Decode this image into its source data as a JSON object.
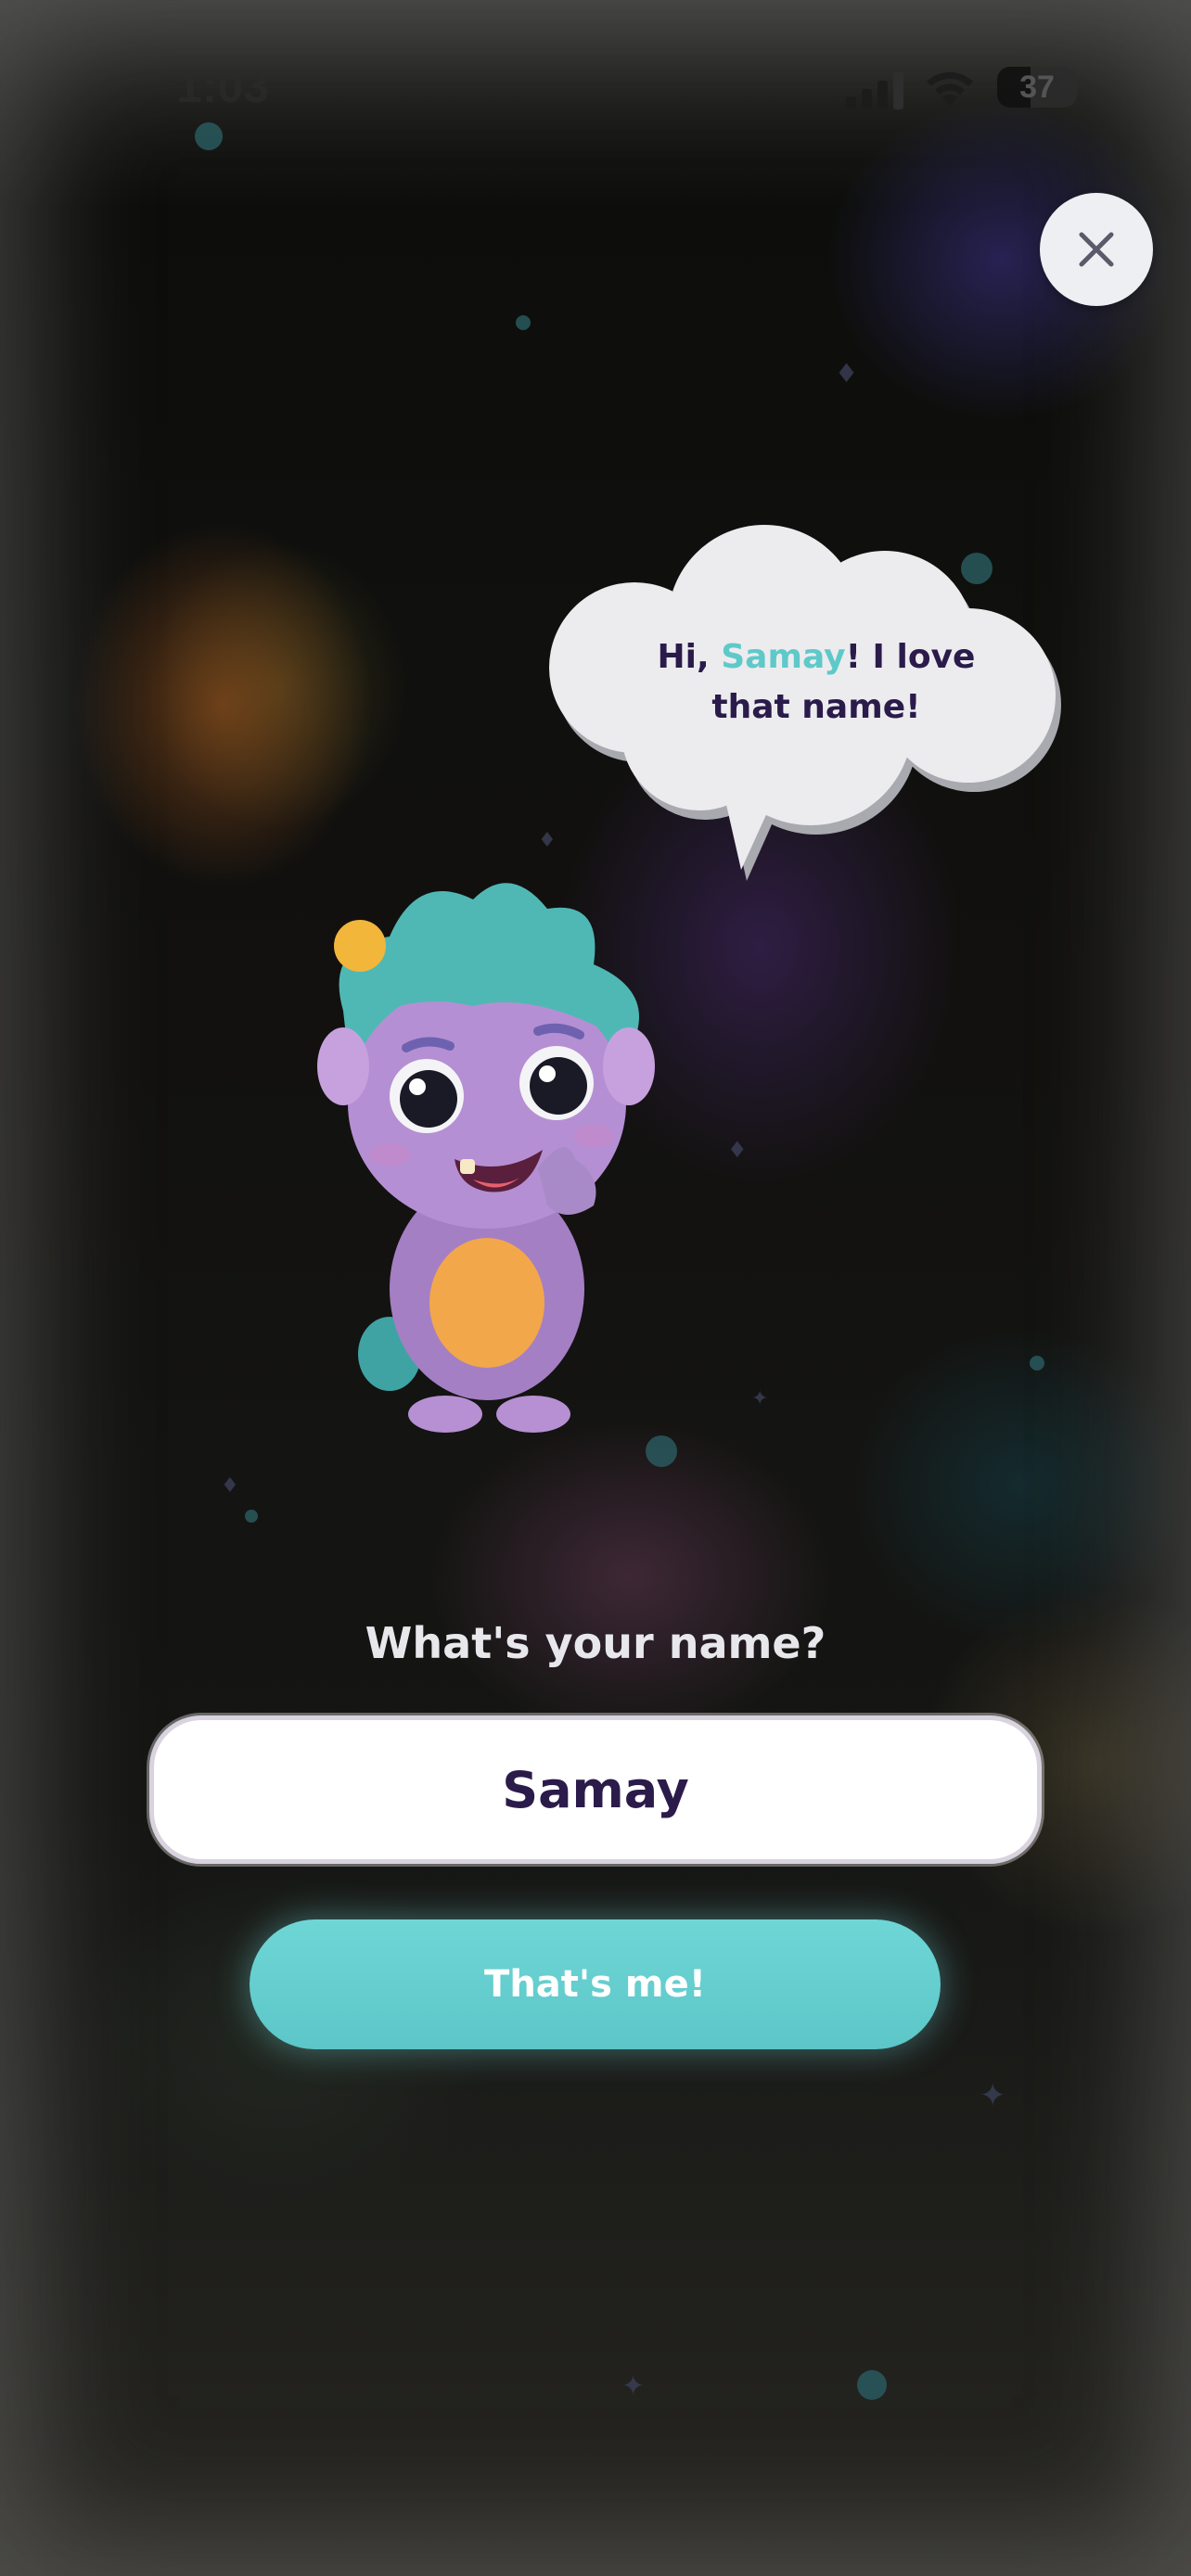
{
  "status_bar": {
    "time": "1:03",
    "battery": "37"
  },
  "close_button": {
    "icon": "close-icon"
  },
  "speech_bubble": {
    "prefix": "Hi, ",
    "name": "Samay",
    "suffix_line1": "! I love",
    "line2": "that name!"
  },
  "mascot": {
    "icon": "purple-monster-mascot"
  },
  "prompt": {
    "question": "What's your name?"
  },
  "name_field": {
    "value": "Samay"
  },
  "confirm_button": {
    "label": "That's me!"
  },
  "colors": {
    "accent": "#5fc9c9",
    "text_dark": "#2b1b4a",
    "button": "#66d0d0"
  }
}
